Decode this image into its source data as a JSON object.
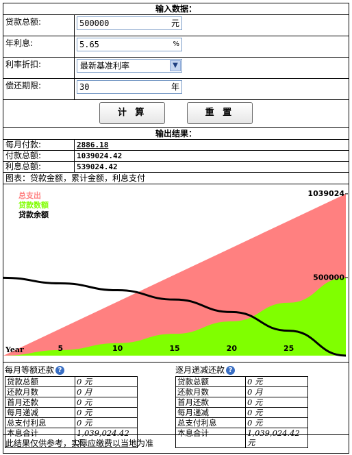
{
  "input_section": {
    "header": "输入数据：",
    "loan_amount": {
      "label": "贷款总额:",
      "value": "500000",
      "unit": "元"
    },
    "interest_rate": {
      "label": "年利息:",
      "value": "5.65",
      "unit": "%"
    },
    "rate_discount": {
      "label": "利率折扣:",
      "selected": "最新基准利率"
    },
    "term": {
      "label": "偿还期限:",
      "value": "30",
      "unit": "年"
    }
  },
  "buttons": {
    "calculate": "计 算",
    "reset": "重 置"
  },
  "output_section": {
    "header": "输出结果：",
    "monthly_payment": {
      "label": "每月付款:",
      "value": "2886.18"
    },
    "total_payment": {
      "label": "付款总额:",
      "value": "1039024.42"
    },
    "total_interest": {
      "label": "利息总额:",
      "value": "539024.42"
    },
    "chart_caption": "图表：贷款金额，累计金额，利息支付"
  },
  "chart_data": {
    "type": "area",
    "x_axis_label": "Year",
    "x_ticks": [
      5,
      10,
      15,
      20,
      25
    ],
    "xlim": [
      0,
      30
    ],
    "y_value_labels": [
      "1039024",
      "500000"
    ],
    "ylim": [
      0,
      1100000
    ],
    "legend": [
      {
        "name": "总支出",
        "color": "#ff8080"
      },
      {
        "name": "贷款数额",
        "color": "#80ff00"
      },
      {
        "name": "贷款余额",
        "color": "#000000"
      }
    ],
    "series": [
      {
        "name": "总支出",
        "color": "#ff8080",
        "x": [
          0,
          5,
          10,
          15,
          20,
          25,
          30
        ],
        "values": [
          0,
          173171,
          346341,
          519512,
          692683,
          865853,
          1039024
        ]
      },
      {
        "name": "贷款数额",
        "color": "#80ff00",
        "x": [
          0,
          5,
          10,
          15,
          20,
          25,
          30
        ],
        "values": [
          0,
          35750,
          80000,
          140000,
          220000,
          340000,
          500000
        ]
      },
      {
        "name": "贷款余额",
        "color": "#000000",
        "x": [
          0,
          5,
          10,
          15,
          20,
          25,
          30
        ],
        "values": [
          500000,
          464250,
          420000,
          360000,
          280000,
          160000,
          0
        ]
      }
    ]
  },
  "equal_payment": {
    "title": "每月等额还款",
    "rows": [
      {
        "k": "贷款总额",
        "v": "0 元"
      },
      {
        "k": "还款月数",
        "v": "0 月"
      },
      {
        "k": "首月还款",
        "v": "0 元"
      },
      {
        "k": "每月递减",
        "v": "0 元"
      },
      {
        "k": "总支付利息",
        "v": "0 元"
      },
      {
        "k": "本息合计",
        "v": "1,039,024.42 元"
      }
    ]
  },
  "decreasing_payment": {
    "title": "逐月递减还款",
    "rows": [
      {
        "k": "贷款总额",
        "v": "0 元"
      },
      {
        "k": "还款月数",
        "v": "0 月"
      },
      {
        "k": "首月还款",
        "v": "0 元"
      },
      {
        "k": "每月递减",
        "v": "0 元"
      },
      {
        "k": "总支付利息",
        "v": "0 元"
      },
      {
        "k": "本息合计",
        "v": "1,039,024.42 元"
      }
    ]
  },
  "help_icon": "?",
  "footer_note": "此结果仅供参考，实际应缴费以当地为准"
}
